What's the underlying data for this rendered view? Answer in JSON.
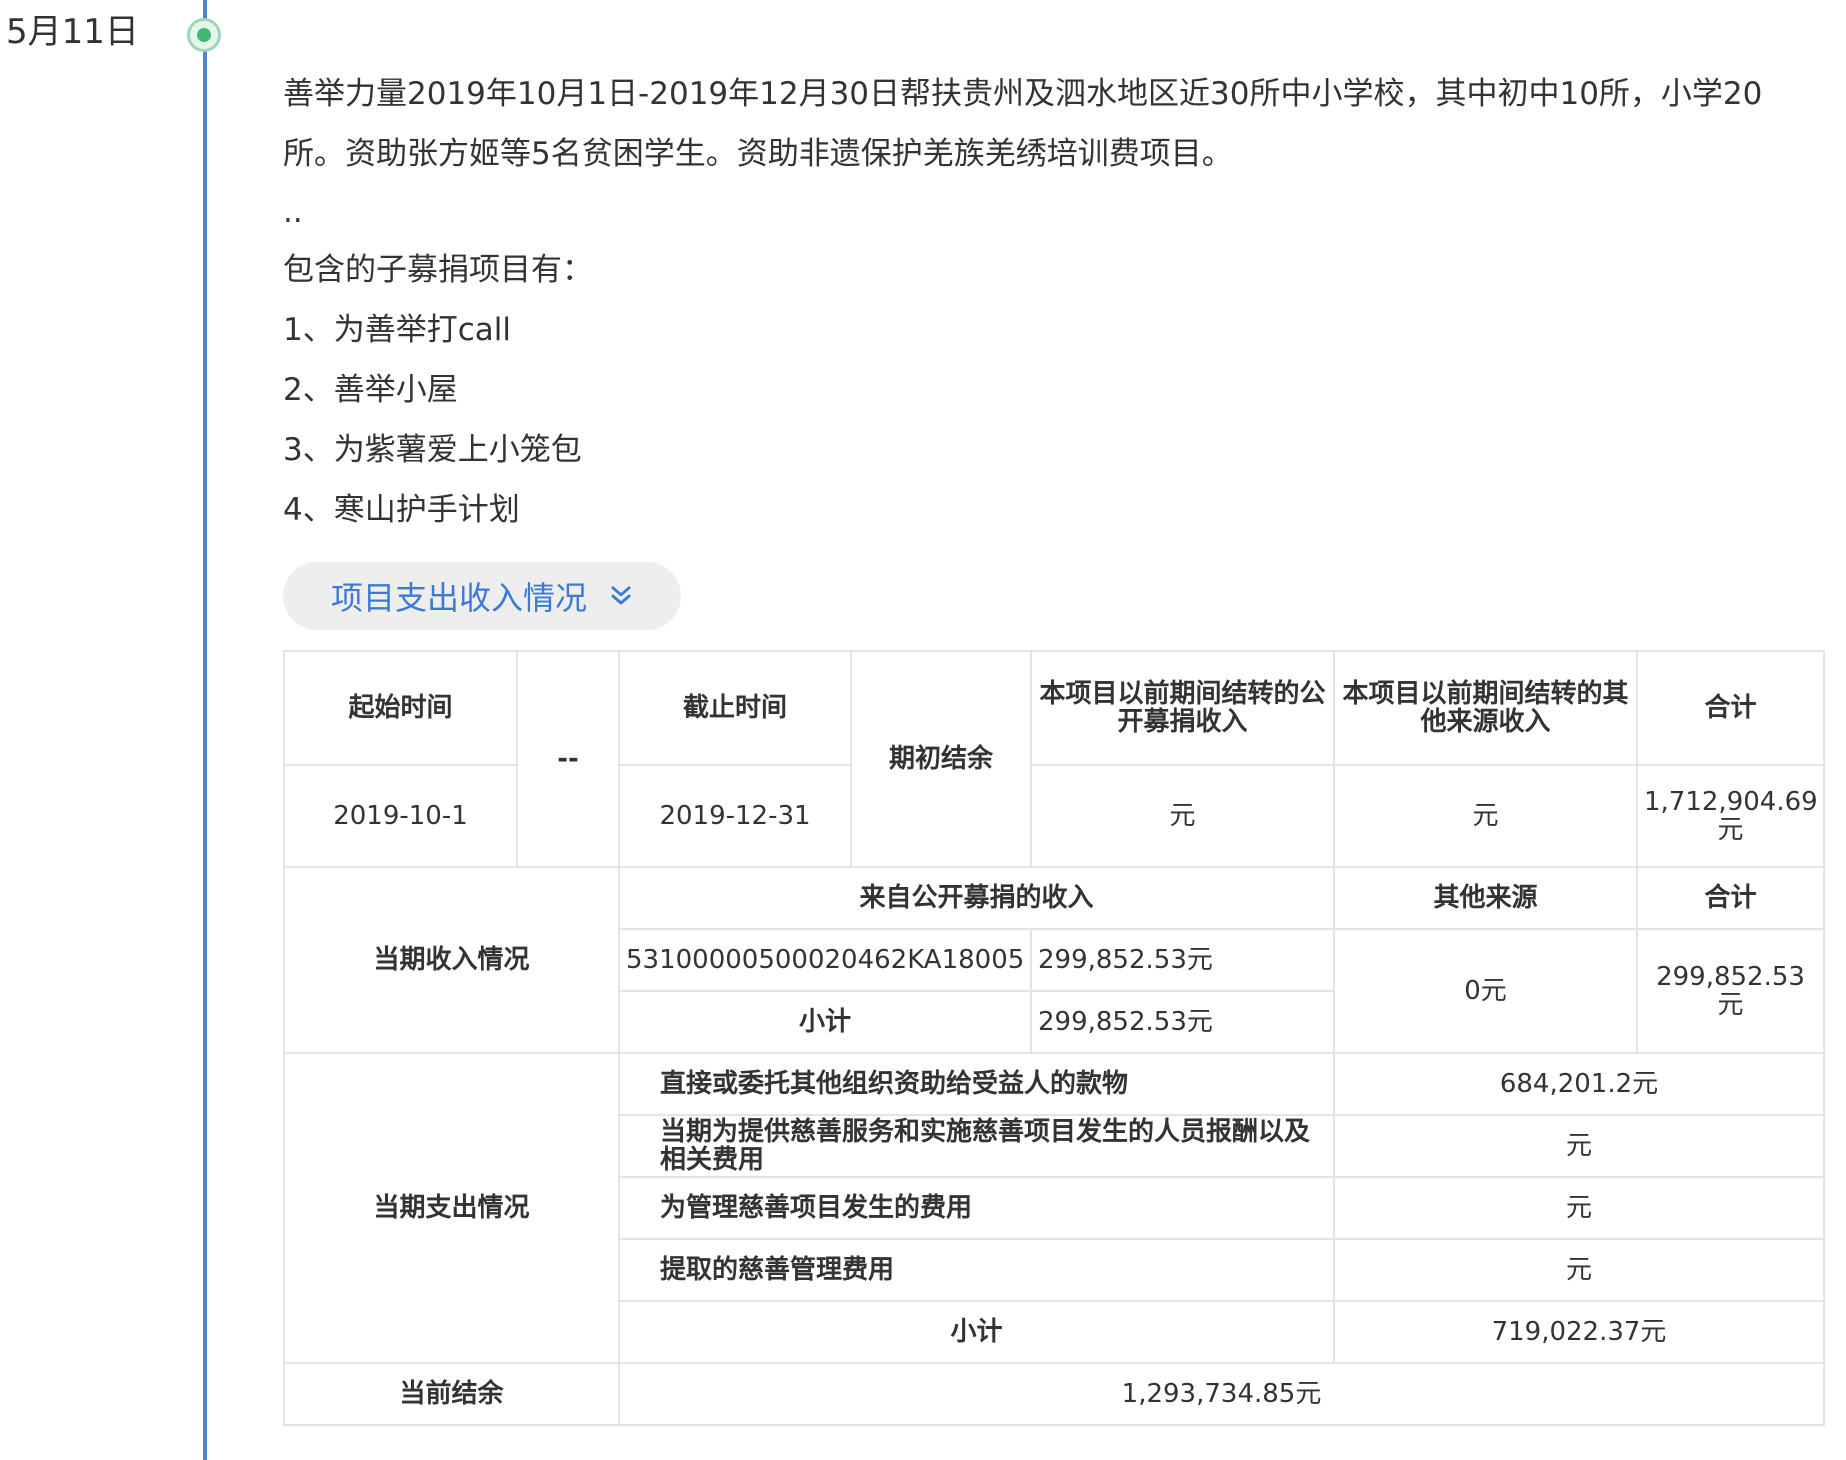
{
  "timeline": {
    "date": "5月11日"
  },
  "description": "善举力量2019年10月1日-2019年12月30日帮扶贵州及泗水地区近30所中小学校，其中初中10所，小学20所。资助张方姬等5名贫困学生。资助非遗保护羌族羌绣培训费项目。",
  "ellipsis": "..",
  "subprojects": {
    "heading": "包含的子募捐项目有：",
    "items": [
      "1、为善举打call",
      "2、善举小屋",
      "3、为紫薯爱上小笼包",
      "4、寒山护手计划"
    ]
  },
  "toggle": {
    "label": "项目支出收入情况",
    "icon": "double-chevron-down-icon",
    "color": "#3b7bd6"
  },
  "table": {
    "header": {
      "start_label": "起始时间",
      "sep": "--",
      "end_label": "截止时间",
      "opening_label": "期初结余",
      "prior_public_label": "本项目以前期间结转的公开募捐收入",
      "prior_other_label": "本项目以前期间结转的其他来源收入",
      "total_label": "合计"
    },
    "period": {
      "start": "2019-10-1",
      "end": "2019-12-31",
      "prior_public": "元",
      "prior_other": "元",
      "total": "1,712,904.69元"
    },
    "income": {
      "label": "当期收入情况",
      "public_label": "来自公开募捐的收入",
      "other_label": "其他来源",
      "total_label": "合计",
      "code": "53100000500020462KA18005",
      "code_amount": "299,852.53元",
      "subtotal_label": "小计",
      "subtotal_amount": "299,852.53元",
      "other_amount": "0元",
      "total_amount": "299,852.53元"
    },
    "expense": {
      "label": "当期支出情况",
      "rows": [
        {
          "label": "直接或委托其他组织资助给受益人的款物",
          "value": "684,201.2元"
        },
        {
          "label": "当期为提供慈善服务和实施慈善项目发生的人员报酬以及相关费用",
          "value": "元"
        },
        {
          "label": "为管理慈善项目发生的费用",
          "value": "元"
        },
        {
          "label": "提取的慈善管理费用",
          "value": "元"
        }
      ],
      "subtotal_label": "小计",
      "subtotal_value": "719,022.37元"
    },
    "balance": {
      "label": "当前结余",
      "value": "1,293,734.85元"
    }
  }
}
